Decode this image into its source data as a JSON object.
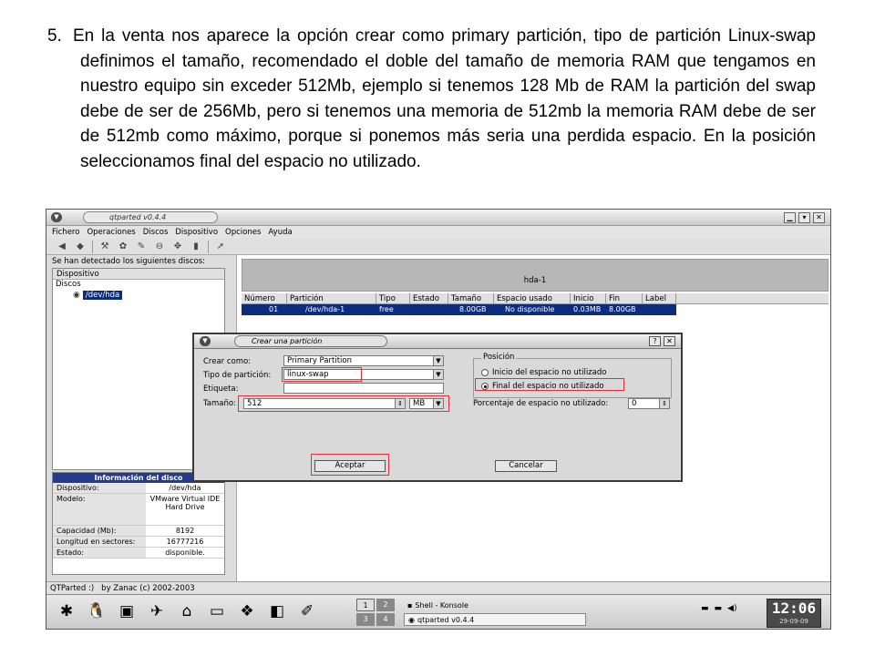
{
  "instruction": {
    "number": "5.",
    "text": "En la venta nos aparece la opción crear como primary partición, tipo de partición Linux-swap definimos el tamaño, recomendado el doble del tamaño de memoria RAM que tengamos en nuestro equipo sin exceder 512Mb, ejemplo si tenemos 128 Mb de RAM la partición del swap debe de ser de 256Mb, pero si tenemos una memoria de 512mb la memoria RAM debe de ser de 512mb como máximo, porque si ponemos más seria una perdida espacio. En la posición seleccionamos final del espacio no utilizado."
  },
  "window": {
    "title": "qtparted v0.4.4",
    "menu": [
      "Fichero",
      "Operaciones",
      "Discos",
      "Dispositivo",
      "Opciones",
      "Ayuda"
    ],
    "toolbar_icons": [
      "undo-icon",
      "redo-icon",
      "tools-icon",
      "format-icon",
      "edit-icon",
      "delete-icon",
      "move-icon",
      "trash-icon",
      "whats-this-icon"
    ]
  },
  "left_pane": {
    "detected_label": "Se han detectado los siguientes discos:",
    "header": "Dispositivo",
    "group": "Discos",
    "device": "/dev/hda"
  },
  "disk_info": {
    "title": "Información del disco",
    "rows": [
      {
        "k": "Dispositivo:",
        "v": "/dev/hda"
      },
      {
        "k": "Modelo:",
        "v": "VMware Virtual IDE Hard Drive"
      },
      {
        "k": "Capacidad (Mb):",
        "v": "8192"
      },
      {
        "k": "Longitud en sectores:",
        "v": "16777216"
      },
      {
        "k": "Estado:",
        "v": "disponible."
      }
    ]
  },
  "disk_map": {
    "label": "hda-1"
  },
  "partition_table": {
    "headers": [
      "Número",
      "Partición",
      "Tipo",
      "Estado",
      "Tamaño",
      "Espacio usado",
      "Inicio",
      "Fin",
      "Label"
    ],
    "row": [
      "01",
      "/dev/hda-1",
      "free",
      "",
      "8.00GB",
      "No disponible",
      "0.03MB",
      "8.00GB",
      ""
    ]
  },
  "dialog": {
    "title": "Crear una partición",
    "crear_como_label": "Crear como:",
    "crear_como_value": "Primary Partition",
    "tipo_label": "Tipo de partición:",
    "tipo_value": "linux-swap",
    "etiqueta_label": "Etiqueta:",
    "etiqueta_value": "",
    "tamano_label": "Tamaño:",
    "tamano_value": "512",
    "unit_value": "MB",
    "posicion_title": "Posición",
    "radio_inicio": "Inicio del espacio no utilizado",
    "radio_final": "Final del espacio no utilizado",
    "porcentaje_label": "Porcentaje de espacio no utilizado:",
    "porcentaje_value": "0",
    "accept": "Aceptar",
    "cancel": "Cancelar",
    "help": "?",
    "close": "✕"
  },
  "statusbar": {
    "left": "QTParted :)",
    "right": "by Zanac (c) 2002-2003"
  },
  "taskbar": {
    "desktops": [
      "1",
      "2",
      "3",
      "4"
    ],
    "tasks": [
      "Shell - Konsole",
      "qtparted v0.4.4"
    ],
    "time": "12:06",
    "date": "29-09-09"
  },
  "colors": {
    "selection": "#0c2c7e",
    "highlight": "#e0303a"
  }
}
